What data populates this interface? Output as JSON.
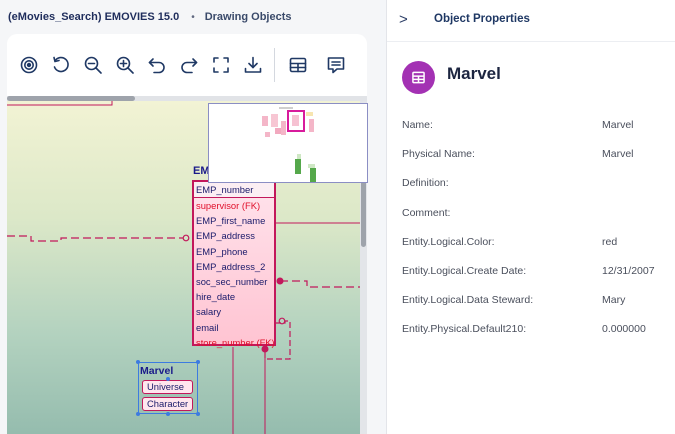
{
  "breadcrumb": {
    "model": "(eMovies_Search) EMOVIES 15.0",
    "separator": "•",
    "page": "Drawing Objects"
  },
  "toolbar": {
    "buttons": [
      {
        "name": "target-icon",
        "label": "Target"
      },
      {
        "name": "refresh-icon",
        "label": "Refresh"
      },
      {
        "name": "zoom-out-icon",
        "label": "Zoom Out"
      },
      {
        "name": "zoom-in-icon",
        "label": "Zoom In"
      },
      {
        "name": "undo-icon",
        "label": "Undo"
      },
      {
        "name": "redo-icon",
        "label": "Redo"
      },
      {
        "name": "fit-screen-icon",
        "label": "Fit to Screen"
      },
      {
        "name": "download-icon",
        "label": "Download"
      },
      {
        "name": "table-icon",
        "label": "Table"
      },
      {
        "name": "comment-icon",
        "label": "Comment"
      }
    ]
  },
  "diagram": {
    "emp": {
      "title": "EMP",
      "pk": "EMP_number",
      "attributes": [
        {
          "text": "supervisor (FK)",
          "fk": true
        },
        {
          "text": "EMP_first_name",
          "fk": false
        },
        {
          "text": "EMP_address",
          "fk": false
        },
        {
          "text": "EMP_phone",
          "fk": false
        },
        {
          "text": "EMP_address_2",
          "fk": false
        },
        {
          "text": "soc_sec_number",
          "fk": false
        },
        {
          "text": "hire_date",
          "fk": false
        },
        {
          "text": "salary",
          "fk": false
        },
        {
          "text": "email",
          "fk": false
        },
        {
          "text": "store_number (FK)",
          "fk": true
        }
      ]
    },
    "marvel": {
      "title": "Marvel",
      "attributes": [
        "Universe",
        "Character"
      ]
    },
    "colors": {
      "entity_border": "#c2185b",
      "fk_text": "#e0102b",
      "selection": "#3d7be0"
    }
  },
  "panel": {
    "title": "Object Properties",
    "entity_name": "Marvel",
    "properties": [
      {
        "label": "Name:",
        "value": "Marvel"
      },
      {
        "label": "Physical Name:",
        "value": "Marvel"
      },
      {
        "label": "Definition:",
        "value": ""
      },
      {
        "label": "Comment:",
        "value": ""
      },
      {
        "label": "Entity.Logical.Color:",
        "value": "red"
      },
      {
        "label": "Entity.Logical.Create Date:",
        "value": "12/31/2007"
      },
      {
        "label": "Entity.Logical.Data Steward:",
        "value": "Mary"
      },
      {
        "label": "Entity.Physical.Default210:",
        "value": "0.000000"
      }
    ],
    "accent_color": "#a331b3"
  }
}
